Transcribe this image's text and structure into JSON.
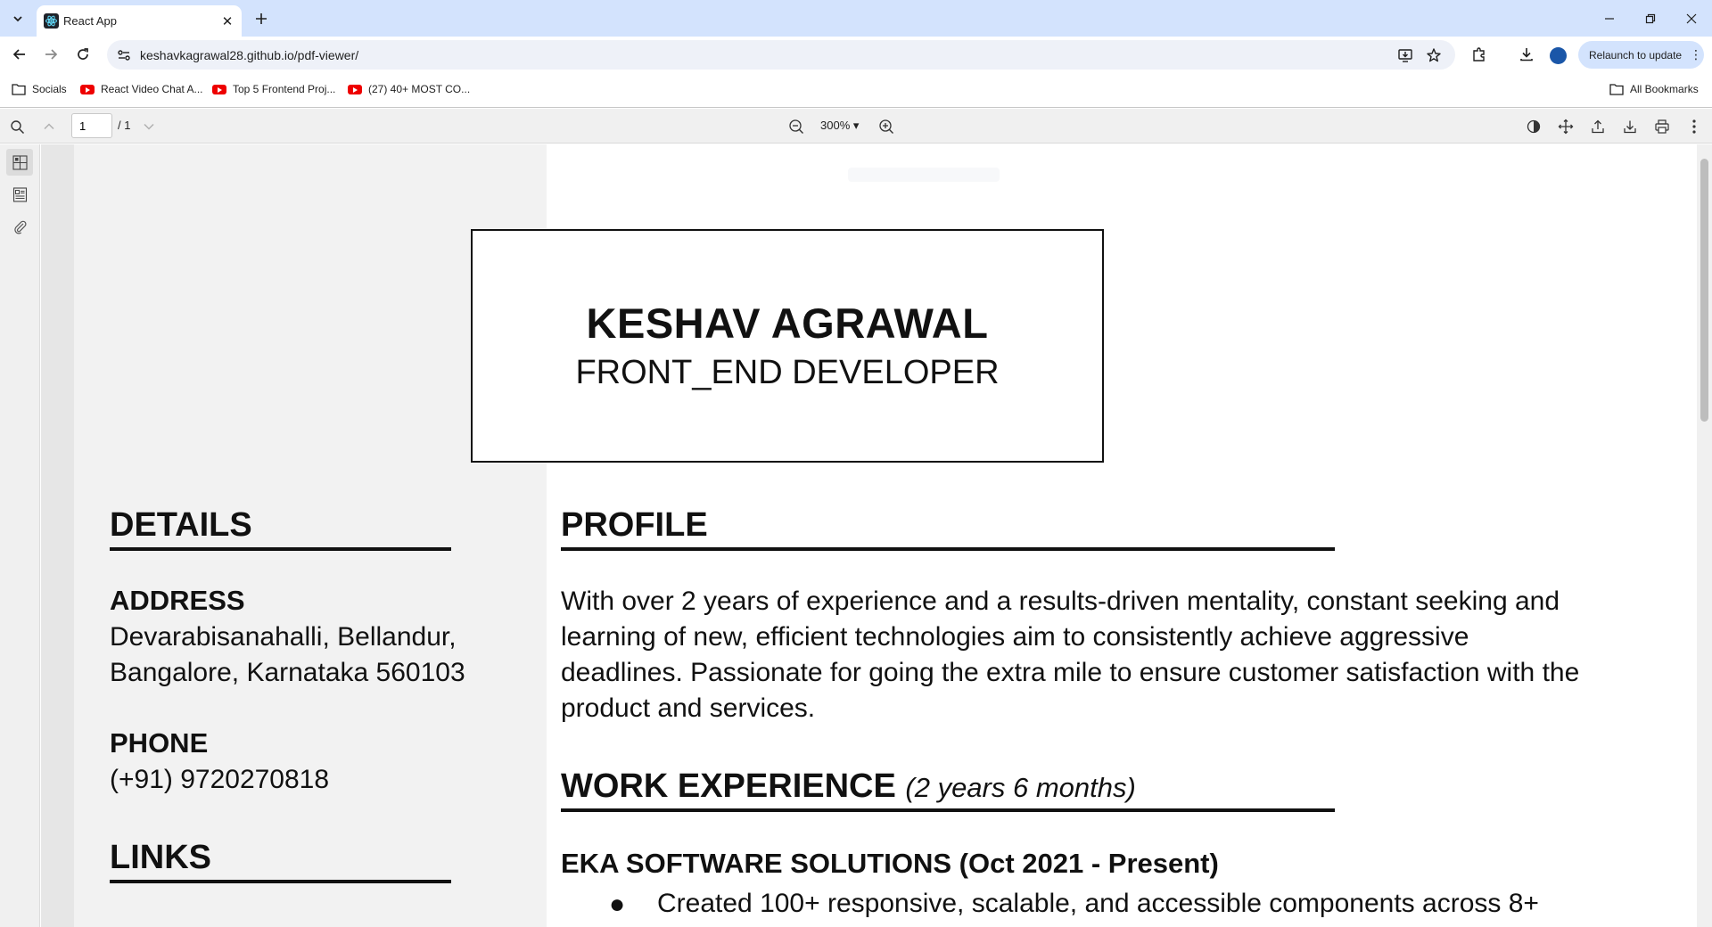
{
  "browser": {
    "tab_title": "React App",
    "tab_close": "✕",
    "url": "keshavkagrawal28.github.io/pdf-viewer/",
    "relaunch_label": "Relaunch to update",
    "bookmarks": [
      {
        "label": "Socials",
        "icon": "folder-icon"
      },
      {
        "label": "React Video Chat A...",
        "icon": "youtube-icon"
      },
      {
        "label": "Top 5 Frontend Proj...",
        "icon": "youtube-icon"
      },
      {
        "label": "(27) 40+ MOST CO...",
        "icon": "youtube-icon"
      }
    ],
    "all_bookmarks": "All Bookmarks",
    "colors": {
      "tabstrip": "#d3e3fd",
      "omnibox": "#eef1f8",
      "profile": "#1a56a8"
    }
  },
  "pdf_toolbar": {
    "page_value": "1",
    "page_total": "/ 1",
    "zoom": "300% ▾"
  },
  "pdf_content": {
    "name": "KESHAV AGRAWAL",
    "role": "FRONT_END DEVELOPER",
    "details": {
      "heading": "DETAILS",
      "address_label": "ADDRESS",
      "address_line1": "Devarabisanahalli, Bellandur,",
      "address_line2": "Bangalore, Karnataka 560103",
      "phone_label": "PHONE",
      "phone": "(+91) 9720270818"
    },
    "links_heading": "LINKS",
    "profile": {
      "heading": "PROFILE",
      "lines": [
        "With over 2 years of experience and a results-driven mentality, constant seeking and",
        "learning of new, efficient technologies aim to consistently achieve aggressive",
        "deadlines. Passionate for going the extra mile to ensure customer satisfaction with the",
        "product and services."
      ]
    },
    "work": {
      "heading": "WORK EXPERIENCE",
      "duration": "(2 years 6 months)",
      "company": "EKA SOFTWARE SOLUTIONS (Oct 2021 - Present)",
      "bullet_mark": "●",
      "bullet1": "Created 100+ responsive, scalable, and accessible components across 8+"
    }
  }
}
